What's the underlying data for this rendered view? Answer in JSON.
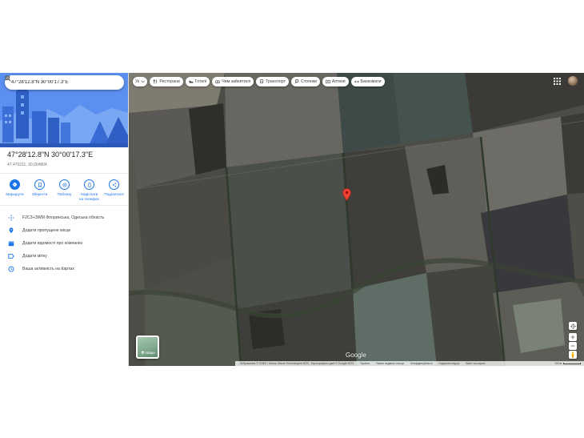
{
  "search": {
    "value": "47°28'12.8\"N 30°00'17.3\"E",
    "search_icon": "search-icon",
    "close_icon": "close-icon"
  },
  "place": {
    "title": "47°28'12.8\"N 30°00'17.3\"E",
    "decimal": "47.470211, 30.004804"
  },
  "actions": [
    {
      "label": "Маршрути",
      "icon": "directions-icon"
    },
    {
      "label": "Зберегти",
      "icon": "bookmark-icon"
    },
    {
      "label": "Поблизу",
      "icon": "nearby-icon"
    },
    {
      "label": "Надіслати\nна телефон",
      "icon": "phone-icon"
    },
    {
      "label": "Поділитися",
      "icon": "share-icon"
    }
  ],
  "rows": [
    {
      "text": "F2C3+3WM Флоринська, Одеська область",
      "icon": "plus-code-icon"
    },
    {
      "text": "Додати пропущене місце",
      "icon": "add-place-icon"
    },
    {
      "text": "Додати відомості про компанію",
      "icon": "business-icon"
    },
    {
      "text": "Додати мітку",
      "icon": "label-icon"
    },
    {
      "text": "Ваша активність на Картах",
      "icon": "history-icon"
    }
  ],
  "chips": {
    "language": "Ук",
    "items": [
      {
        "label": "Ресторани",
        "icon": "restaurant-icon"
      },
      {
        "label": "Готелі",
        "icon": "hotel-icon"
      },
      {
        "label": "Чим зайнятися",
        "icon": "attractions-icon"
      },
      {
        "label": "Транспорт",
        "icon": "transit-icon"
      },
      {
        "label": "Стоянки",
        "icon": "parking-icon"
      },
      {
        "label": "Аптеки",
        "icon": "pharmacy-icon"
      },
      {
        "label": "Банкомати",
        "icon": "atm-icon"
      }
    ]
  },
  "map": {
    "layers_label": "Шари",
    "google": "Google",
    "footer": [
      "Зображення © CNES / Airbus, Maxar Technologies 2023 , Картографічні дані © Google 2023",
      "Україна",
      "Умови надання послуг",
      "Конфіденційність",
      "Надіслати відгук",
      "Вміст на картах"
    ],
    "scale": "100 м",
    "accent": "#1a73e8",
    "pin_color": "#ea4335"
  }
}
